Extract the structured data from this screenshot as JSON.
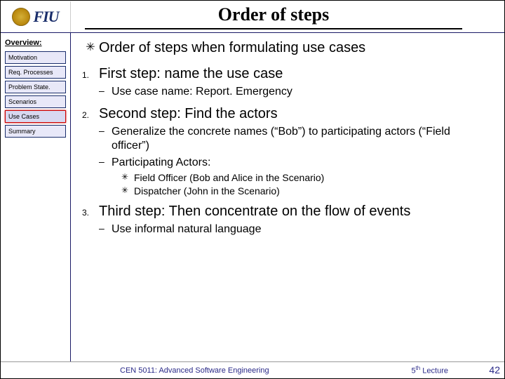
{
  "header": {
    "logo_text": "FIU",
    "title": "Order of steps"
  },
  "sidebar": {
    "heading": "Overview:",
    "items": [
      {
        "label": "Motivation",
        "active": false
      },
      {
        "label": "Req. Processes",
        "active": false
      },
      {
        "label": "Problem State.",
        "active": false
      },
      {
        "label": "Scenarios",
        "active": false
      },
      {
        "label": "Use Cases",
        "active": true
      },
      {
        "label": "Summary",
        "active": false
      }
    ]
  },
  "content": {
    "intro": "Order of steps when formulating use cases",
    "step1": {
      "num": "1.",
      "text": "First step: name the use case",
      "sub": "Use case name: Report. Emergency"
    },
    "step2": {
      "num": "2.",
      "text": "Second step: Find the actors",
      "sub_a": "Generalize the concrete names (“Bob”) to participating actors (“Field officer”)",
      "sub_b": "Participating Actors:",
      "actors": [
        "Field Officer (Bob and Alice in the Scenario)",
        "Dispatcher (John in the Scenario)"
      ]
    },
    "step3": {
      "num": "3.",
      "text": "Third step: Then concentrate on  the flow of events",
      "sub": "Use informal natural language"
    }
  },
  "footer": {
    "course": "CEN 5011: Advanced Software Engineering",
    "lecture_pre": "5",
    "lecture_sup": "th",
    "lecture_post": " Lecture",
    "page": "42"
  }
}
